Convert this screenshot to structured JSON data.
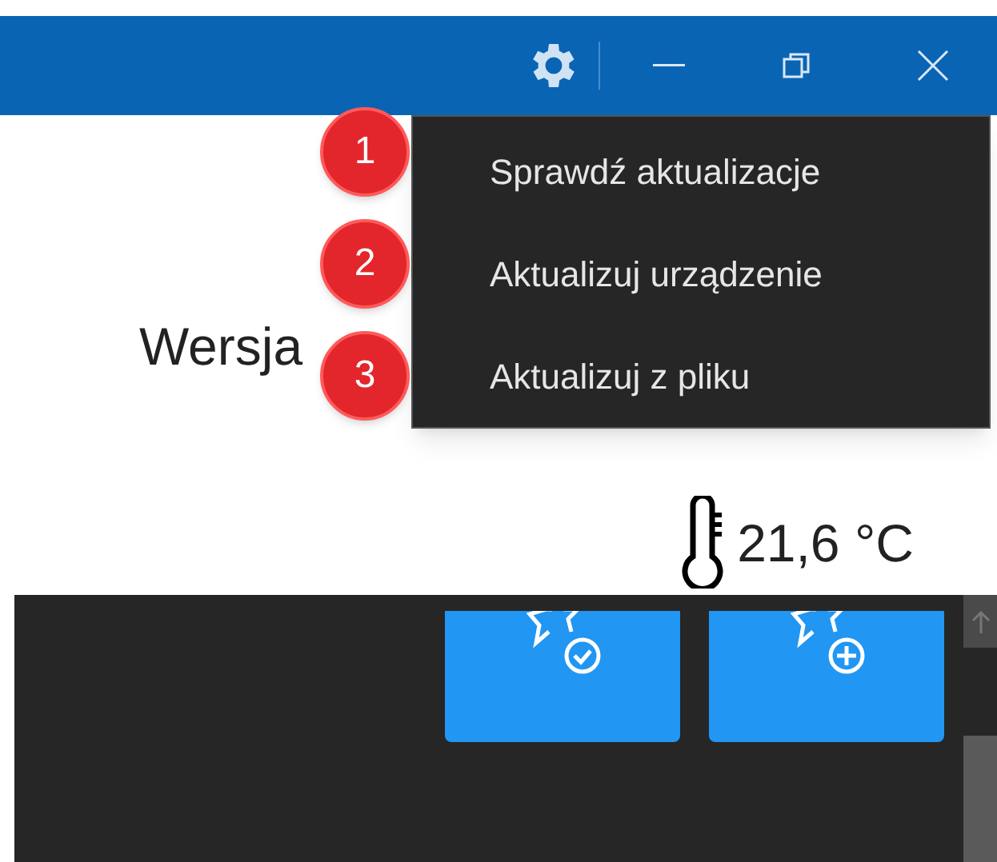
{
  "menu": {
    "items": [
      {
        "label": "Sprawdź aktualizacje"
      },
      {
        "label": "Aktualizuj urządzenie"
      },
      {
        "label": "Aktualizuj z pliku"
      }
    ]
  },
  "annotations": [
    "1",
    "2",
    "3"
  ],
  "content": {
    "version_label": "Wersja",
    "temperature": "21,6 °C"
  }
}
